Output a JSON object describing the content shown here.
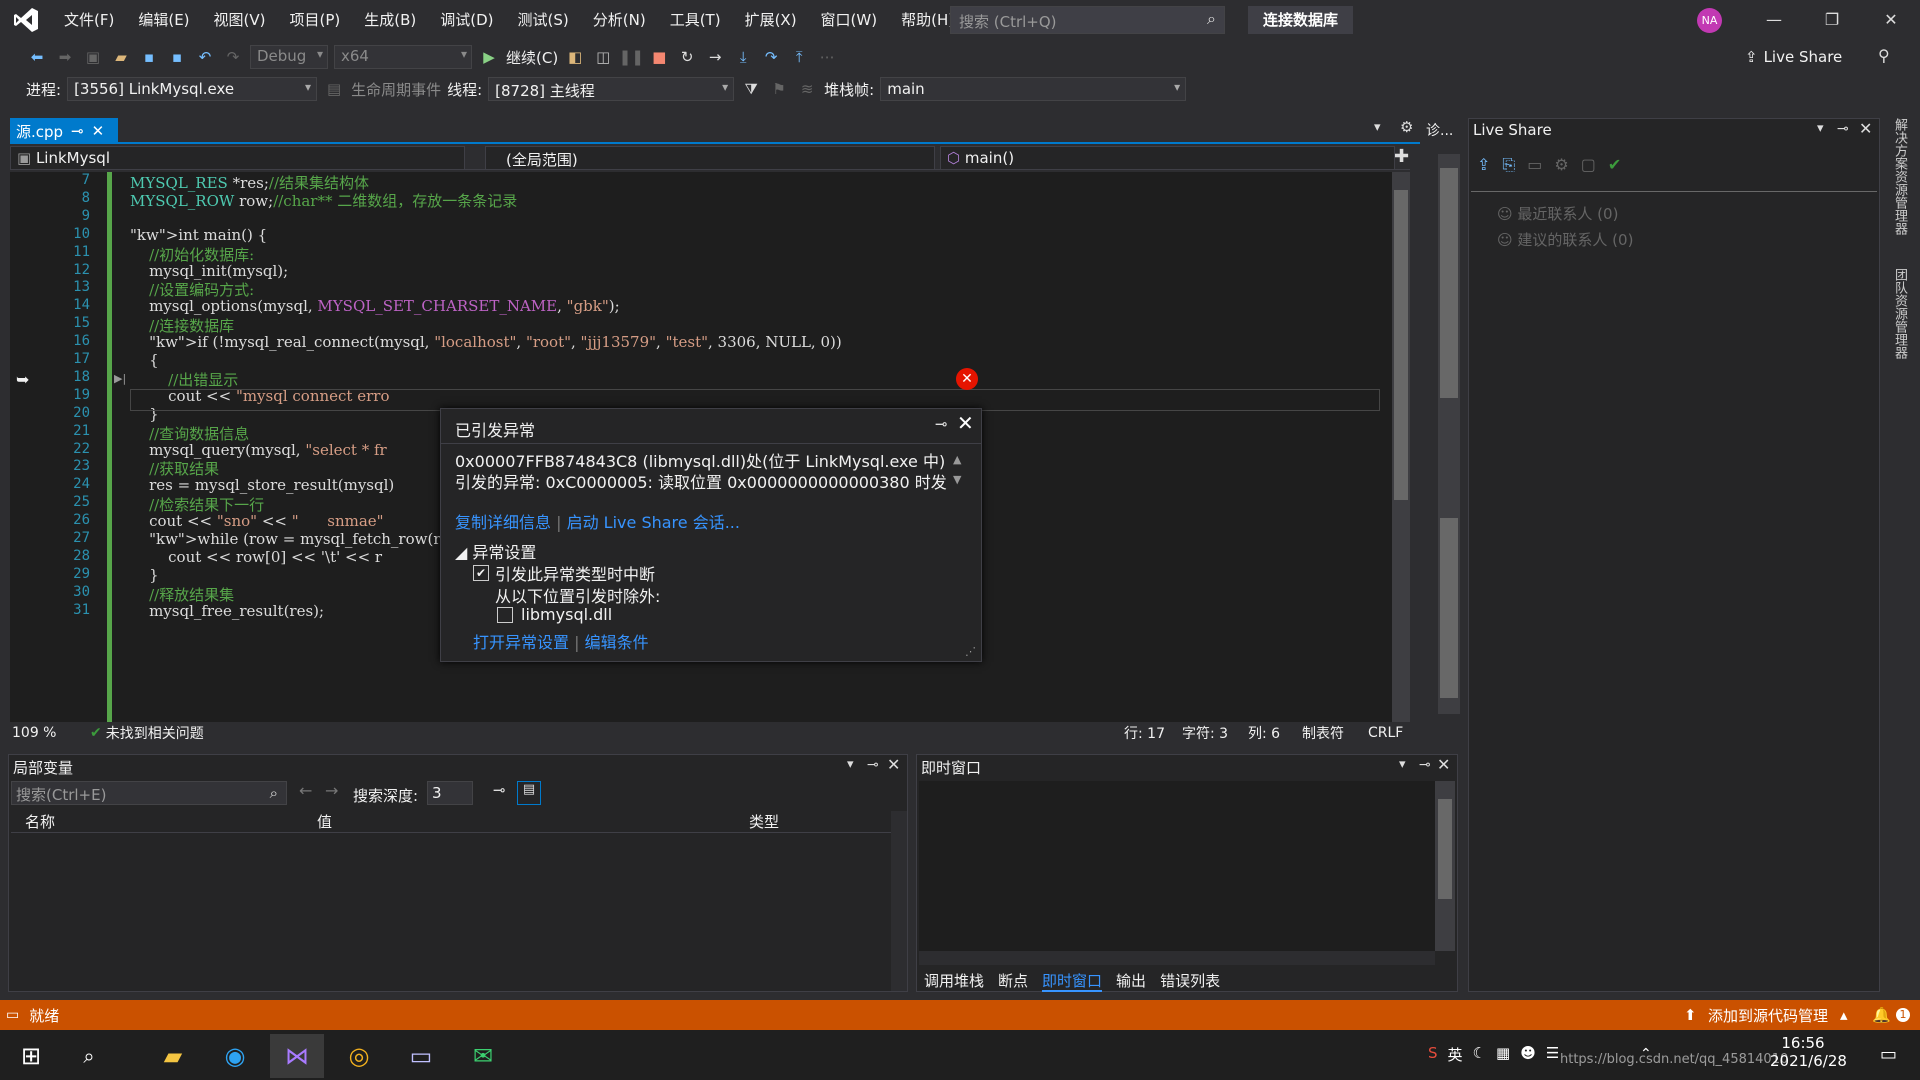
{
  "menu": [
    "文件(F)",
    "编辑(E)",
    "视图(V)",
    "项目(P)",
    "生成(B)",
    "调试(D)",
    "测试(S)",
    "分析(N)",
    "工具(T)",
    "扩展(X)",
    "窗口(W)",
    "帮助(H)"
  ],
  "search": {
    "placeholder": "搜索 (Ctrl+Q)"
  },
  "solution_name": "连接数据库",
  "avatar": "NA",
  "toolbar": {
    "config": "Debug",
    "platform": "x64",
    "continue_label": "继续(C)",
    "liveshare_label": "Live Share"
  },
  "debugbar": {
    "process_label": "进程:",
    "process_value": "[3556] LinkMysql.exe",
    "lifecycle_label": "生命周期事件",
    "thread_label": "线程:",
    "thread_value": "[8728] 主线程",
    "stack_label": "堆栈帧:",
    "stack_value": "main"
  },
  "doc_tab": {
    "name": "源.cpp"
  },
  "navbar": {
    "project": "LinkMysql",
    "scope": "(全局范围)",
    "member": "main()"
  },
  "code_lines": [
    {
      "n": "7",
      "html": "MYSQL_RES *res;//结果集结构体"
    },
    {
      "n": "8",
      "html": "MYSQL_ROW row;//char** 二维数组，存放一条条记录"
    },
    {
      "n": "9",
      "html": ""
    },
    {
      "n": "10",
      "html": "int main() {"
    },
    {
      "n": "11",
      "html": "    //初始化数据库:"
    },
    {
      "n": "12",
      "html": "    mysql_init(mysql);"
    },
    {
      "n": "13",
      "html": "    //设置编码方式:"
    },
    {
      "n": "14",
      "html": "    mysql_options(mysql, MYSQL_SET_CHARSET_NAME, \"gbk\");"
    },
    {
      "n": "15",
      "html": "    //连接数据库"
    },
    {
      "n": "16",
      "html": "    if (!mysql_real_connect(mysql, \"localhost\", \"root\", \"jjj13579\", \"test\", 3306, NULL, 0))"
    },
    {
      "n": "17",
      "html": "    {"
    },
    {
      "n": "18",
      "html": "        //出错显示"
    },
    {
      "n": "19",
      "html": "        cout << \"mysql connect erro"
    },
    {
      "n": "20",
      "html": "    }"
    },
    {
      "n": "21",
      "html": "    //查询数据信息"
    },
    {
      "n": "22",
      "html": "    mysql_query(mysql, \"select * fr"
    },
    {
      "n": "23",
      "html": "    //获取结果"
    },
    {
      "n": "24",
      "html": "    res = mysql_store_result(mysql)"
    },
    {
      "n": "25",
      "html": "    //检索结果下一行"
    },
    {
      "n": "26",
      "html": "    cout << \"sno\" << \"      snmae\""
    },
    {
      "n": "27",
      "html": "    while (row = mysql_fetch_row(re"
    },
    {
      "n": "28",
      "html": "        cout << row[0] << '\\t' << r"
    },
    {
      "n": "29",
      "html": "    }"
    },
    {
      "n": "30",
      "html": "    //释放结果集"
    },
    {
      "n": "31",
      "html": "    mysql_free_result(res);"
    }
  ],
  "exception": {
    "title": "已引发异常",
    "line1": "0x00007FFB874843C8 (libmysql.dll)处(位于 LinkMysql.exe 中)",
    "line2": "引发的异常: 0xC0000005: 读取位置 0x0000000000000380 时发",
    "copy_details": "复制详细信息",
    "start_liveshare": "启动 Live Share 会话...",
    "settings_header": "异常设置",
    "break_when": "引发此异常类型时中断",
    "except_from": "从以下位置引发时除外:",
    "dll": "libmysql.dll",
    "open_settings": "打开异常设置",
    "edit_conditions": "编辑条件"
  },
  "editor_status": {
    "zoom": "109 %",
    "issues": "未找到相关问题",
    "line": "行: 17",
    "char": "字符: 3",
    "col": "列: 6",
    "tab": "制表符",
    "eol": "CRLF"
  },
  "locals": {
    "title": "局部变量",
    "search_placeholder": "搜索(Ctrl+E)",
    "depth_label": "搜索深度:",
    "depth_value": "3",
    "col_name": "名称",
    "col_value": "值",
    "col_type": "类型"
  },
  "immediate": {
    "title": "即时窗口",
    "tabs": [
      "调用堆栈",
      "断点",
      "即时窗口",
      "输出",
      "错误列表"
    ]
  },
  "liveshare_panel": {
    "title": "Live Share",
    "recent": "最近联系人 (0)",
    "suggested": "建议的联系人 (0)"
  },
  "diag_tab": "诊...",
  "side_tabs": [
    "解决方案资源管理器",
    "团队资源管理器"
  ],
  "statusbar": {
    "ready": "就绪",
    "source_control": "添加到源代码管理",
    "notif": "1"
  },
  "taskbar": {
    "time": "16:56",
    "date": "2021/6/28",
    "lang": "英",
    "watermark": "https://blog.csdn.net/qq_45814010"
  }
}
